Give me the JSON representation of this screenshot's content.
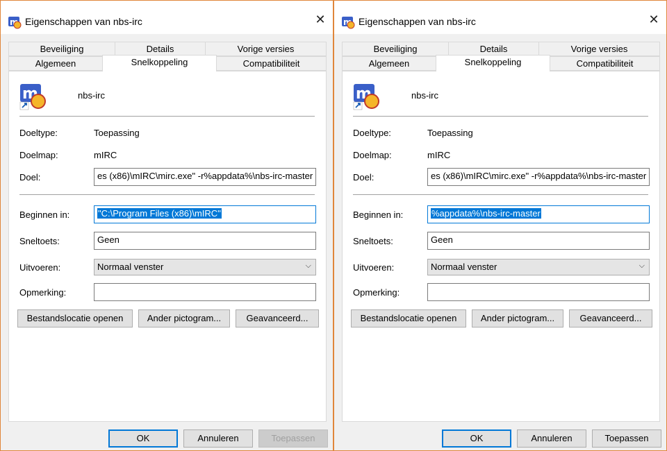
{
  "dialogs": [
    {
      "title": "Eigenschappen van nbs-irc",
      "close_glyph": "✕",
      "tabs_back": [
        "Beveiliging",
        "Details",
        "Vorige versies"
      ],
      "tabs_front": [
        "Algemeen",
        "Snelkoppeling",
        "Compatibiliteit"
      ],
      "active_tab": "Snelkoppeling",
      "app_name": "nbs-irc",
      "doeltype_label": "Doeltype:",
      "doeltype_value": "Toepassing",
      "doelmap_label": "Doelmap:",
      "doelmap_value": "mIRC",
      "doel_label": "Doel:",
      "doel_value": "es (x86)\\mIRC\\mirc.exe\" -r%appdata%\\nbs-irc-master",
      "beginnen_label": "Beginnen in:",
      "beginnen_value": "\"C:\\Program Files (x86)\\mIRC\"",
      "sneltoets_label": "Sneltoets:",
      "sneltoets_value": "Geen",
      "uitvoeren_label": "Uitvoeren:",
      "uitvoeren_value": "Normaal venster",
      "opmerking_label": "Opmerking:",
      "opmerking_value": "",
      "btn_bestand": "Bestandslocatie openen",
      "btn_pictogram": "Ander pictogram...",
      "btn_geavanceerd": "Geavanceerd...",
      "btn_ok": "OK",
      "btn_annuleren": "Annuleren",
      "btn_toepassen": "Toepassen",
      "toepassen_enabled": false
    },
    {
      "title": "Eigenschappen van nbs-irc",
      "close_glyph": "✕",
      "tabs_back": [
        "Beveiliging",
        "Details",
        "Vorige versies"
      ],
      "tabs_front": [
        "Algemeen",
        "Snelkoppeling",
        "Compatibiliteit"
      ],
      "active_tab": "Snelkoppeling",
      "app_name": "nbs-irc",
      "doeltype_label": "Doeltype:",
      "doeltype_value": "Toepassing",
      "doelmap_label": "Doelmap:",
      "doelmap_value": "mIRC",
      "doel_label": "Doel:",
      "doel_value": "es (x86)\\mIRC\\mirc.exe\" -r%appdata%\\nbs-irc-master",
      "beginnen_label": "Beginnen in:",
      "beginnen_value": "%appdata%\\nbs-irc-master",
      "sneltoets_label": "Sneltoets:",
      "sneltoets_value": "Geen",
      "uitvoeren_label": "Uitvoeren:",
      "uitvoeren_value": "Normaal venster",
      "opmerking_label": "Opmerking:",
      "opmerking_value": "",
      "btn_bestand": "Bestandslocatie openen",
      "btn_pictogram": "Ander pictogram...",
      "btn_geavanceerd": "Geavanceerd...",
      "btn_ok": "OK",
      "btn_annuleren": "Annuleren",
      "btn_toepassen": "Toepassen",
      "toepassen_enabled": true
    }
  ],
  "colors": {
    "accent": "#0078d7",
    "window_border": "#e0863a",
    "dialog_bg": "#f0f0f0"
  }
}
